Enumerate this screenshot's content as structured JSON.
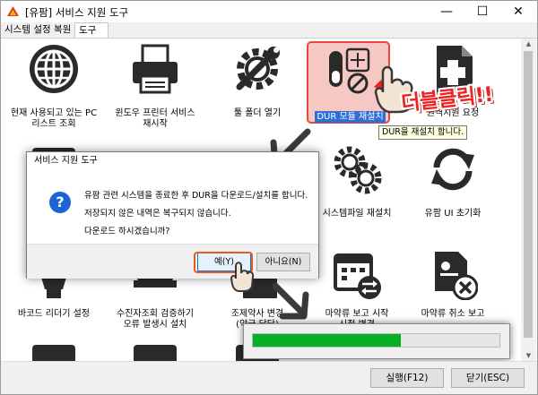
{
  "window": {
    "title": "[유팜] 서비스 지원 도구",
    "minimize_glyph": "—",
    "maximize_glyph": "☐",
    "close_glyph": "✕"
  },
  "tabs": [
    {
      "label": "시스템 설정 복원",
      "active": false
    },
    {
      "label": "도구",
      "active": true
    }
  ],
  "grid_items": [
    {
      "id": "pc-info",
      "icon": "globe-icon",
      "label_lines": [
        "현재 사용되고 있는 PC",
        "리스트 조회"
      ]
    },
    {
      "id": "printer",
      "icon": "printer-icon",
      "label_lines": [
        "윈도우 프린터 서비스",
        "재시작"
      ]
    },
    {
      "id": "tool-folder",
      "icon": "wrench-gear-icon",
      "label_lines": [
        "툴 폴더 열기"
      ]
    },
    {
      "id": "dur",
      "icon": "dur-pill-icon",
      "label_lines": [
        "DUR 모듈 재설치"
      ]
    },
    {
      "id": "request",
      "icon": "medical-doc-icon",
      "label_lines": [
        "원격지원 요청"
      ]
    },
    {
      "id": "barcode-left",
      "icon": "barcode-icon",
      "label_lines": []
    },
    {
      "id": "sysfile",
      "icon": "gears-icon",
      "label_lines": [
        "시스템파일 재설치"
      ]
    },
    {
      "id": "ui-reset",
      "icon": "refresh-icon",
      "label_lines": [
        "유팜 UI 초기화"
      ]
    },
    {
      "id": "barcode-reader",
      "icon": "scanner-icon",
      "label_lines": [
        "바코드 리더기 설정"
      ]
    },
    {
      "id": "reissue",
      "icon": "stamp-icon",
      "label_lines": [
        "수진자조회 검증하기",
        "오류 발생시 설치"
      ]
    },
    {
      "id": "supplier",
      "icon": "supplier-doc-icon",
      "label_lines": [
        "조제약사 변경",
        "(약국 담당)"
      ]
    },
    {
      "id": "report-start",
      "icon": "calendar-swap-icon",
      "label_lines": [
        "마약류 보고 시작",
        "시점 변경"
      ]
    },
    {
      "id": "report-cancel",
      "icon": "doc-cancel-icon",
      "label_lines": [
        "마약류 취소 보고"
      ]
    }
  ],
  "selected_item": {
    "label": "DUR 모듈 재설치",
    "tooltip": "DUR을 재설치 합니다."
  },
  "annotation": {
    "double_click_text": "더블클릭!!"
  },
  "dialog": {
    "title": "서비스 지원 도구",
    "icon": "question-icon",
    "lines": [
      "유팜 관련 시스템을 종료한 후 DUR을 다운로드/설치를 합니다.",
      "저장되지 않은 내역은 복구되지 않습니다.",
      "다운로드 하시겠습니까?"
    ],
    "yes_label": "예(Y)",
    "no_label": "아니요(N)"
  },
  "progress": {
    "fraction": 0.6
  },
  "footer": {
    "run_label": "실행(F12)",
    "close_label": "닫기(ESC)"
  },
  "colors": {
    "selected_fill": "#f6c8c4",
    "selected_border": "#e64a3c",
    "progress_green": "#06b025",
    "annotation_red": "#ef2222",
    "dialog_question_blue": "#1e63d6"
  }
}
